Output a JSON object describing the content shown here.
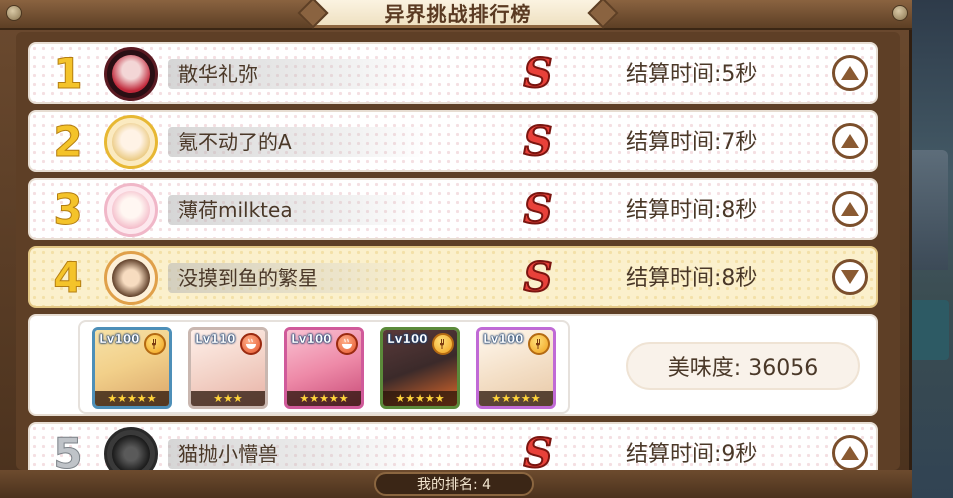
{
  "title": "异界挑战排行榜",
  "rows": [
    {
      "rank": "1",
      "name": "散华礼弥",
      "grade": "S",
      "time": "结算时间:5秒",
      "expanded": false,
      "avatar_color": "#c0283a"
    },
    {
      "rank": "2",
      "name": "氪不动了的A",
      "grade": "S",
      "time": "结算时间:7秒",
      "expanded": false,
      "avatar_color": "#e9c77a"
    },
    {
      "rank": "3",
      "name": "薄荷milktea",
      "grade": "S",
      "time": "结算时间:8秒",
      "expanded": false,
      "avatar_color": "#f3b9c8"
    },
    {
      "rank": "4",
      "name": "没摸到鱼的繁星",
      "grade": "S",
      "time": "结算时间:8秒",
      "expanded": true,
      "avatar_color": "#d9955a"
    },
    {
      "rank": "5",
      "name": "猫抛小懵兽",
      "grade": "S",
      "time": "结算时间:9秒",
      "expanded": false,
      "avatar_color": "#3a3a3a"
    }
  ],
  "detail": {
    "flavor": "美味度: 36056",
    "team": [
      {
        "level": "Lv100",
        "stars": 5,
        "frame": "#4d8fb8",
        "art": "#f2d08a"
      },
      {
        "level": "Lv110",
        "stars": 3,
        "frame": "#c9b7b0",
        "art": "#f3d3c8"
      },
      {
        "level": "Lv100",
        "stars": 5,
        "frame": "#d05a9a",
        "art": "#ee8aa8"
      },
      {
        "level": "Lv100",
        "stars": 5,
        "frame": "#5b8a3a",
        "art": "#3b2a2a"
      },
      {
        "level": "Lv100",
        "stars": 5,
        "frame": "#c06ad6",
        "art": "#f4e0c8"
      }
    ]
  },
  "my_rank": "我的排名:  4",
  "colors": {
    "frame_wood": "#6b4a2f",
    "rank_gold": "#f4c32a",
    "grade_red": "#e8413a",
    "selected_row": "#fbf0cc"
  }
}
